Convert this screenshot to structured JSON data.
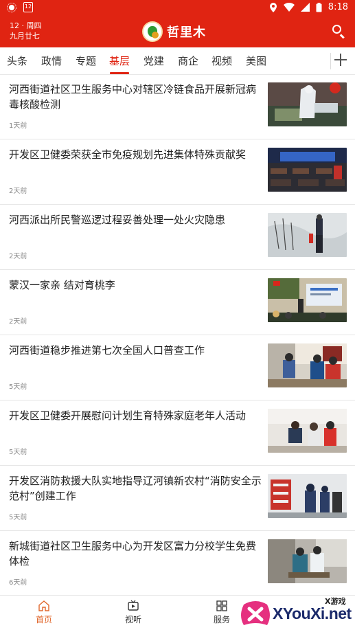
{
  "status_bar": {
    "time": "8:18",
    "calendar_day": "12"
  },
  "header": {
    "date_line1": "12 · 周四",
    "date_line2": "九月廿七",
    "app_name": "哲里木",
    "logo_mark": "云上"
  },
  "tabs": [
    {
      "label": "头条"
    },
    {
      "label": "政情"
    },
    {
      "label": "专题"
    },
    {
      "label": "基层",
      "active": true
    },
    {
      "label": "党建"
    },
    {
      "label": "商企"
    },
    {
      "label": "视频"
    },
    {
      "label": "美图"
    }
  ],
  "news": [
    {
      "title": "河西街道社区卫生服务中心对辖区冷链食品开展新冠病毒核酸检测",
      "time": "1天前"
    },
    {
      "title": "开发区卫健委荣获全市免疫规划先进集体特殊贡献奖",
      "time": "2天前"
    },
    {
      "title": "河西派出所民警巡逻过程妥善处理一处火灾隐患",
      "time": "2天前"
    },
    {
      "title": "蒙汉一家亲  结对育桃李",
      "time": "2天前"
    },
    {
      "title": "河西街道稳步推进第七次全国人口普查工作",
      "time": "5天前"
    },
    {
      "title": "开发区卫健委开展慰问计划生育特殊家庭老年人活动",
      "time": "5天前"
    },
    {
      "title": "开发区消防救援大队实地指导辽河镇新农村“消防安全示范村”创建工作",
      "time": "5天前"
    },
    {
      "title": "新城街道社区卫生服务中心为开发区富力分校学生免费体检",
      "time": "6天前"
    }
  ],
  "bottom_nav": [
    {
      "label": "首页",
      "icon": "home-icon",
      "active": true
    },
    {
      "label": "视听",
      "icon": "video-icon"
    },
    {
      "label": "服务",
      "icon": "grid-icon"
    }
  ],
  "watermark": {
    "text": "XYouXi.net",
    "small": "X游戏"
  },
  "colors": {
    "brand_red": "#e02412",
    "nav_active": "#e0662a"
  }
}
